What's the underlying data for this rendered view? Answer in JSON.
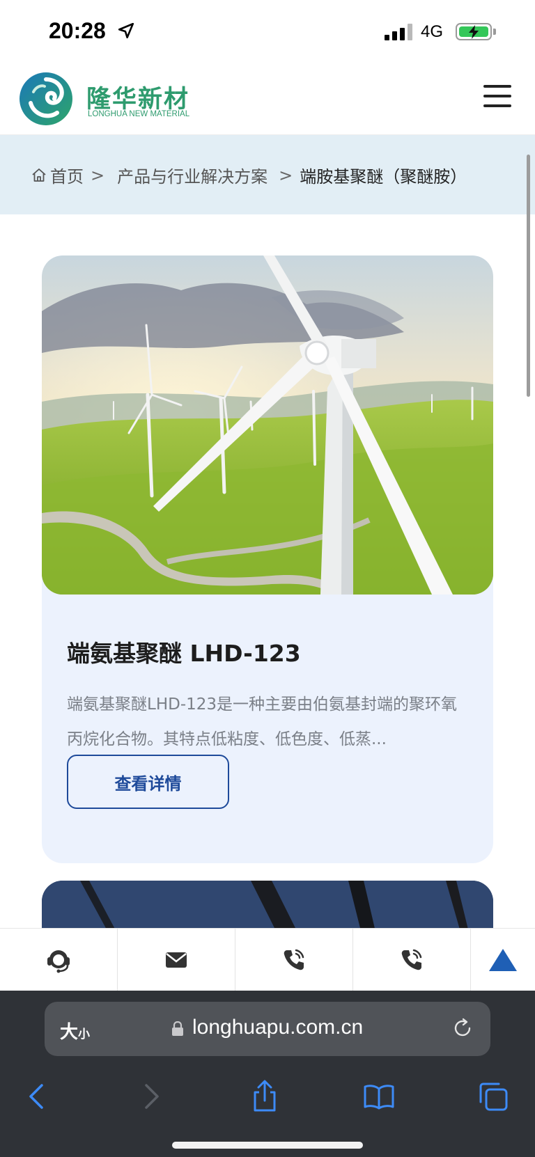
{
  "status_bar": {
    "time": "20:28",
    "network": "4G"
  },
  "header": {
    "logo_cn": "隆华新材",
    "logo_en": "LONGHUA NEW MATERIAL",
    "brand_colors": {
      "green": "#2e9b6e",
      "blue": "#1f6fb5"
    }
  },
  "breadcrumb": {
    "home": "首页",
    "separator": ">",
    "level2": "产品与行业解决方案",
    "current": "端胺基聚醚（聚醚胺）"
  },
  "product_card": {
    "image_alt": "wind-turbines-landscape",
    "title": "端氨基聚醚 LHD-123",
    "description": "端氨基聚醚LHD-123是一种主要由伯氨基封端的聚环氧丙烷化合物。其特点低粘度、低色度、低蒸...",
    "button_label": "查看详情",
    "accent": "#1e4a9a"
  },
  "contact_bar": {
    "items": [
      "customer-service-icon",
      "mail-icon",
      "phone-icon",
      "phone-icon"
    ],
    "back_to_top": "up-arrow-icon",
    "accent": "#1f5fb5"
  },
  "browser": {
    "text_size_label": "大",
    "text_size_small": "小",
    "url": "longhuapu.com.cn"
  }
}
